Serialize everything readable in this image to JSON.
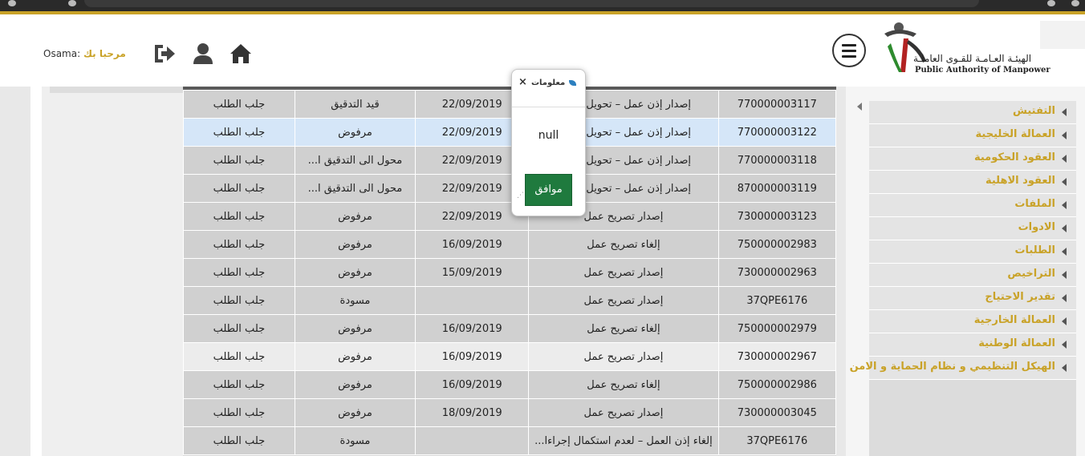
{
  "header": {
    "logo_ar": "الهيئـة العـامـة للقـوى العاملـة",
    "logo_en": "Public Authority of Manpower",
    "welcome_prefix": "مرحبا بك",
    "username": "Osama:"
  },
  "table": {
    "rows": [
      {
        "id": "770000003117",
        "type": "إصدار إذن عمل – تحويل من ...",
        "date": "22/09/2019",
        "status": "قيد التدقيق",
        "action": "جلب الطلب",
        "style": "normal"
      },
      {
        "id": "770000003122",
        "type": "إصدار إذن عمل – تحويل من ...",
        "date": "22/09/2019",
        "status": "مرفوض",
        "action": "جلب الطلب",
        "style": "sel"
      },
      {
        "id": "770000003118",
        "type": "إصدار إذن عمل – تحويل من ...",
        "date": "22/09/2019",
        "status": "محول الى التدقيق ا...",
        "action": "جلب الطلب",
        "style": "normal"
      },
      {
        "id": "870000003119",
        "type": "إصدار إذن عمل – تحويل من ...",
        "date": "22/09/2019",
        "status": "محول الى التدقيق ا...",
        "action": "جلب الطلب",
        "style": "normal"
      },
      {
        "id": "730000003123",
        "type": "إصدار تصريح عمل",
        "date": "22/09/2019",
        "status": "مرفوض",
        "action": "جلب الطلب",
        "style": "normal"
      },
      {
        "id": "750000002983",
        "type": "إلغاء تصريح عمل",
        "date": "16/09/2019",
        "status": "مرفوض",
        "action": "جلب الطلب",
        "style": "normal"
      },
      {
        "id": "730000002963",
        "type": "إصدار تصريح عمل",
        "date": "15/09/2019",
        "status": "مرفوض",
        "action": "جلب الطلب",
        "style": "normal"
      },
      {
        "id": "37QPE6176",
        "type": "إصدار تصريح عمل",
        "date": "",
        "status": "مسودة",
        "action": "جلب الطلب",
        "style": "normal"
      },
      {
        "id": "750000002979",
        "type": "إلغاء تصريح عمل",
        "date": "16/09/2019",
        "status": "مرفوض",
        "action": "جلب الطلب",
        "style": "normal"
      },
      {
        "id": "730000002967",
        "type": "إصدار تصريح عمل",
        "date": "16/09/2019",
        "status": "مرفوض",
        "action": "جلب الطلب",
        "style": "light"
      },
      {
        "id": "750000002986",
        "type": "إلغاء تصريح عمل",
        "date": "16/09/2019",
        "status": "مرفوض",
        "action": "جلب الطلب",
        "style": "normal"
      },
      {
        "id": "730000003045",
        "type": "إصدار تصريح عمل",
        "date": "18/09/2019",
        "status": "مرفوض",
        "action": "جلب الطلب",
        "style": "normal"
      },
      {
        "id": "37QPE6176",
        "type": "إلغاء إذن العمل – لعدم استكمال إجراءا...",
        "date": "",
        "status": "مسودة",
        "action": "جلب الطلب",
        "style": "normal"
      }
    ]
  },
  "sidebar": {
    "items": [
      {
        "label": "التفتيش"
      },
      {
        "label": "العمالة الخليجية"
      },
      {
        "label": "العقود الحكومية"
      },
      {
        "label": "العقود الاهلية"
      },
      {
        "label": "الملفات"
      },
      {
        "label": "الادوات"
      },
      {
        "label": "الطلبات"
      },
      {
        "label": "التراخيص"
      },
      {
        "label": "تقدير الاحتياج"
      },
      {
        "label": "العمالة الخارجية"
      },
      {
        "label": "العمالة الوطنية"
      },
      {
        "label": "الهيكل التنظيمي و نظام الحماية و الامن"
      }
    ]
  },
  "dialog": {
    "title": "معلومات",
    "close": "×",
    "message": "null",
    "ok_label": "موافق"
  },
  "colors": {
    "accent_gold": "#c9a227",
    "ok_green": "#1f7a3e",
    "selected_row": "#d5e6f8"
  }
}
